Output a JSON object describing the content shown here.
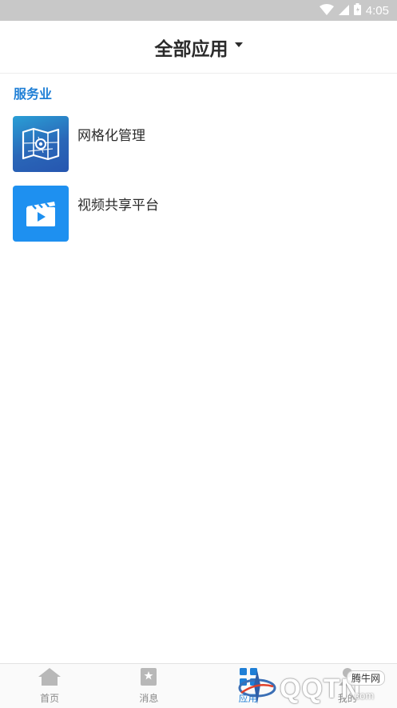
{
  "status_bar": {
    "time": "4:05",
    "icons": [
      "wifi-icon",
      "signal-icon",
      "battery-icon"
    ],
    "background": "#c8c8c8"
  },
  "header": {
    "title": "全部应用",
    "dropdown_icon": "caret-down-icon"
  },
  "section": {
    "title": "服务业",
    "title_color": "#1f7fd6",
    "apps": [
      {
        "label": "网格化管理",
        "icon": "map-grid-icon",
        "color": "#2a67b8"
      },
      {
        "label": "视频共享平台",
        "icon": "video-play-icon",
        "color": "#1e90f0"
      }
    ]
  },
  "bottom_nav": {
    "items": [
      {
        "label": "首页",
        "icon": "home-icon",
        "active": false
      },
      {
        "label": "消息",
        "icon": "message-icon",
        "active": false
      },
      {
        "label": "应用",
        "icon": "apps-icon",
        "active": true
      },
      {
        "label": "我的",
        "icon": "profile-icon",
        "active": false
      }
    ],
    "active_color": "#1f7fd6",
    "inactive_color": "#8a8a8a"
  },
  "watermark": {
    "logo_text": "QQTN",
    "suffix": ".com",
    "tag": "腾牛网"
  }
}
